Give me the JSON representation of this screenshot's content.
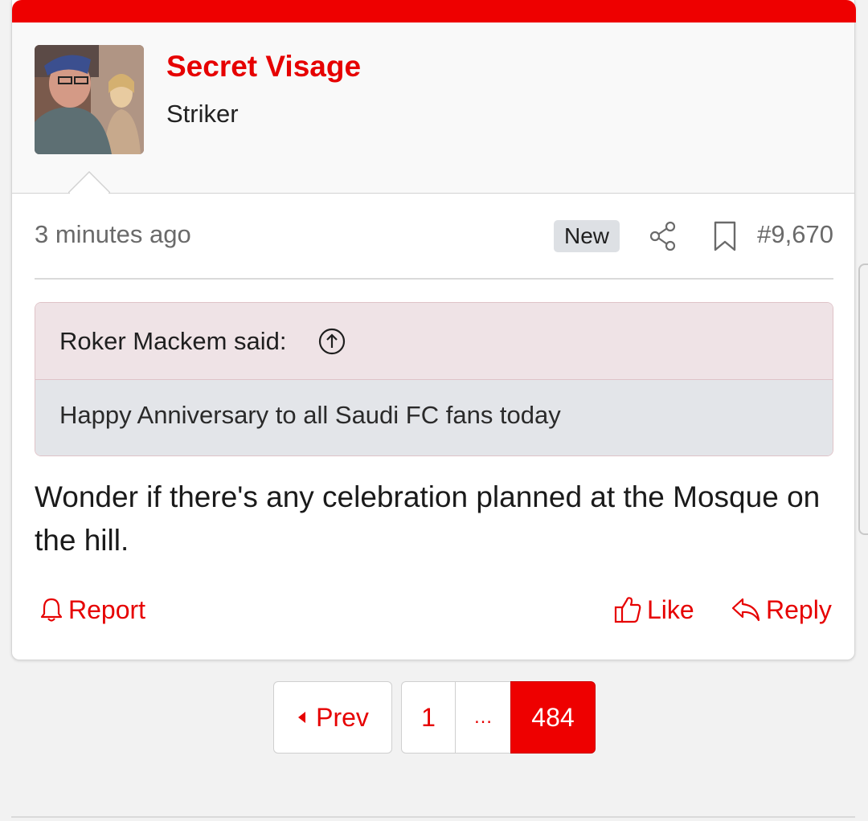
{
  "post": {
    "username": "Secret Visage",
    "user_title": "Striker",
    "timestamp": "3 minutes ago",
    "badge": "New",
    "post_number": "#9,670",
    "quote": {
      "author": "Roker Mackem said:",
      "text": "Happy Anniversary to all Saudi FC fans today"
    },
    "body": "Wonder if there's any celebration planned at the Mosque on the hill.",
    "actions": {
      "report": "Report",
      "like": "Like",
      "reply": "Reply"
    }
  },
  "pagination": {
    "prev": "Prev",
    "first": "1",
    "ellipsis": "…",
    "current": "484"
  },
  "icons": [
    "avatar-photo",
    "share-icon",
    "bookmark-icon",
    "quote-up-arrow-icon",
    "bell-icon",
    "thumbs-up-icon",
    "reply-arrow-icon",
    "caret-left-icon"
  ],
  "colors": {
    "accent": "#ee0000",
    "link_red": "#e60000",
    "quote_head_bg": "#efe3e6",
    "quote_body_bg": "#e3e5e9",
    "badge_bg": "#dde0e4"
  }
}
